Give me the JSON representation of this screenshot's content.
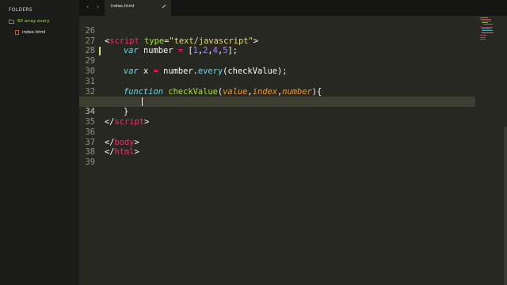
{
  "sidebar": {
    "header": "FOLDERS",
    "folder": "60 array every",
    "file": "index.html"
  },
  "tabbar": {
    "back_icon": "chevron-left-icon",
    "forward_icon": "chevron-right-icon",
    "active_tab": "index.html"
  },
  "editor": {
    "current_line": 34,
    "lines": [
      {
        "n": "26"
      },
      {
        "n": "27"
      },
      {
        "n": "28"
      },
      {
        "n": "29"
      },
      {
        "n": "30"
      },
      {
        "n": "31"
      },
      {
        "n": "32"
      },
      {
        "n": "33"
      },
      {
        "n": "34"
      },
      {
        "n": "35"
      },
      {
        "n": "36"
      },
      {
        "n": "37"
      },
      {
        "n": "38"
      },
      {
        "n": "39"
      }
    ],
    "tokens": {
      "l28": [
        "<",
        "script",
        " type",
        "=",
        "\"text/javascript\"",
        ">"
      ],
      "l29": [
        "var",
        " number ",
        "=",
        " [",
        "1",
        ",",
        "2",
        ",",
        "4",
        ",",
        "5",
        "];"
      ],
      "l31": [
        "var",
        " x ",
        "=",
        " number.",
        "every",
        "(checkValue);"
      ],
      "l33": [
        "function",
        " ",
        "checkValue",
        "(",
        "value",
        ",",
        "index",
        ",",
        "number",
        "){"
      ],
      "l35": [
        "}"
      ],
      "l36": [
        "</",
        "script",
        ">"
      ],
      "l38": [
        "</",
        "body",
        ">"
      ],
      "l39": [
        "</",
        "html",
        ">"
      ]
    }
  },
  "colors": {
    "editor_bg": "#272822",
    "sidebar_bg": "#1b1c19",
    "tag": "#f92672",
    "attr": "#a6e22e",
    "string": "#e6db74",
    "keyword": "#66d9ef",
    "number": "#ae81ff",
    "param": "#fd971f"
  }
}
